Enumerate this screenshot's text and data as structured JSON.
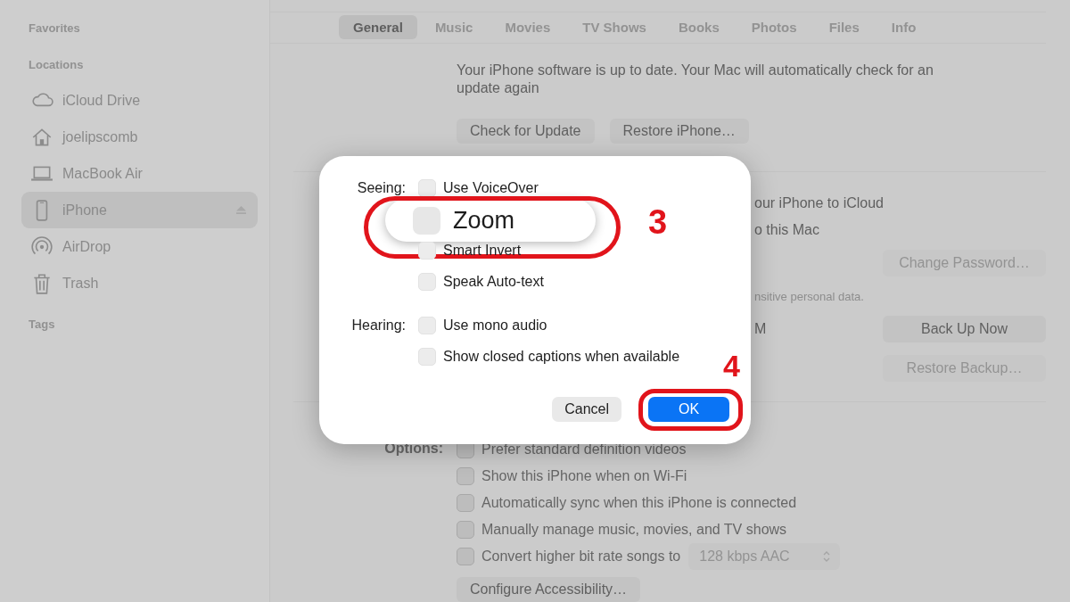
{
  "sidebar": {
    "sections": [
      {
        "heading": "Favorites"
      },
      {
        "heading": "Locations",
        "items": [
          {
            "kind": "cloud",
            "label": "iCloud Drive",
            "selected": false,
            "ejectable": false
          },
          {
            "kind": "home",
            "label": "joelipscomb",
            "selected": false,
            "ejectable": false
          },
          {
            "kind": "laptop",
            "label": "MacBook Air",
            "selected": false,
            "ejectable": false
          },
          {
            "kind": "phone",
            "label": "iPhone",
            "selected": true,
            "ejectable": true
          },
          {
            "kind": "airdrop",
            "label": "AirDrop",
            "selected": false,
            "ejectable": false
          },
          {
            "kind": "trash",
            "label": "Trash",
            "selected": false,
            "ejectable": false
          }
        ]
      },
      {
        "heading": "Tags"
      }
    ]
  },
  "tabs": [
    {
      "label": "General",
      "selected": true
    },
    {
      "label": "Music",
      "selected": false
    },
    {
      "label": "Movies",
      "selected": false
    },
    {
      "label": "TV Shows",
      "selected": false
    },
    {
      "label": "Books",
      "selected": false
    },
    {
      "label": "Photos",
      "selected": false
    },
    {
      "label": "Files",
      "selected": false
    },
    {
      "label": "Info",
      "selected": false
    }
  ],
  "software": {
    "message": "Your iPhone software is up to date. Your Mac will automatically check for an update again",
    "buttons": [
      {
        "label": "Check for Update",
        "disabled": false
      },
      {
        "label": "Restore iPhone…",
        "disabled": false
      }
    ]
  },
  "backup": {
    "rows": [
      {
        "kind": "text",
        "text": "our iPhone to iCloud"
      },
      {
        "kind": "text",
        "text": "o this Mac"
      },
      {
        "kind": "text",
        "button": {
          "label": "Change Password…",
          "disabled": true
        }
      },
      {
        "kind": "note",
        "text": "nsitive personal data."
      },
      {
        "kind": "text",
        "text": "M",
        "button": {
          "label": "Back Up Now",
          "disabled": false
        }
      },
      {
        "kind": "text",
        "button": {
          "label": "Restore Backup…",
          "disabled": true
        }
      }
    ]
  },
  "options": {
    "label": "Options:",
    "items": [
      {
        "label": "Prefer standard definition videos",
        "checked": false
      },
      {
        "label": "Show this iPhone when on Wi-Fi",
        "checked": false
      },
      {
        "label": "Automatically sync when this iPhone is connected",
        "checked": false
      },
      {
        "label": "Manually manage music, movies, and TV shows",
        "checked": false
      },
      {
        "label": "Convert higher bit rate songs to",
        "checked": false,
        "popup": {
          "value": "128 kbps AAC",
          "disabled": true
        }
      }
    ],
    "button": {
      "label": "Configure Accessibility…",
      "disabled": false
    }
  },
  "dialog": {
    "groups": [
      {
        "label": "Seeing:",
        "items": [
          {
            "kind": "normal",
            "label": "Use VoiceOver",
            "checked": false
          },
          {
            "kind": "magnified",
            "label": "Zoom",
            "checked": false,
            "highlighted": true,
            "step": "3"
          },
          {
            "kind": "normal",
            "label": "Smart Invert",
            "checked": false
          },
          {
            "kind": "normal",
            "label": "Speak Auto-text",
            "checked": false
          }
        ]
      },
      {
        "label": "Hearing:",
        "items": [
          {
            "kind": "normal",
            "label": "Use mono audio",
            "checked": false
          },
          {
            "kind": "normal",
            "label": "Show closed captions when available",
            "checked": false
          }
        ]
      }
    ],
    "buttons": [
      {
        "label": "Cancel",
        "default": false,
        "highlighted": false
      },
      {
        "label": "OK",
        "default": true,
        "highlighted": true,
        "step": "4"
      }
    ]
  }
}
